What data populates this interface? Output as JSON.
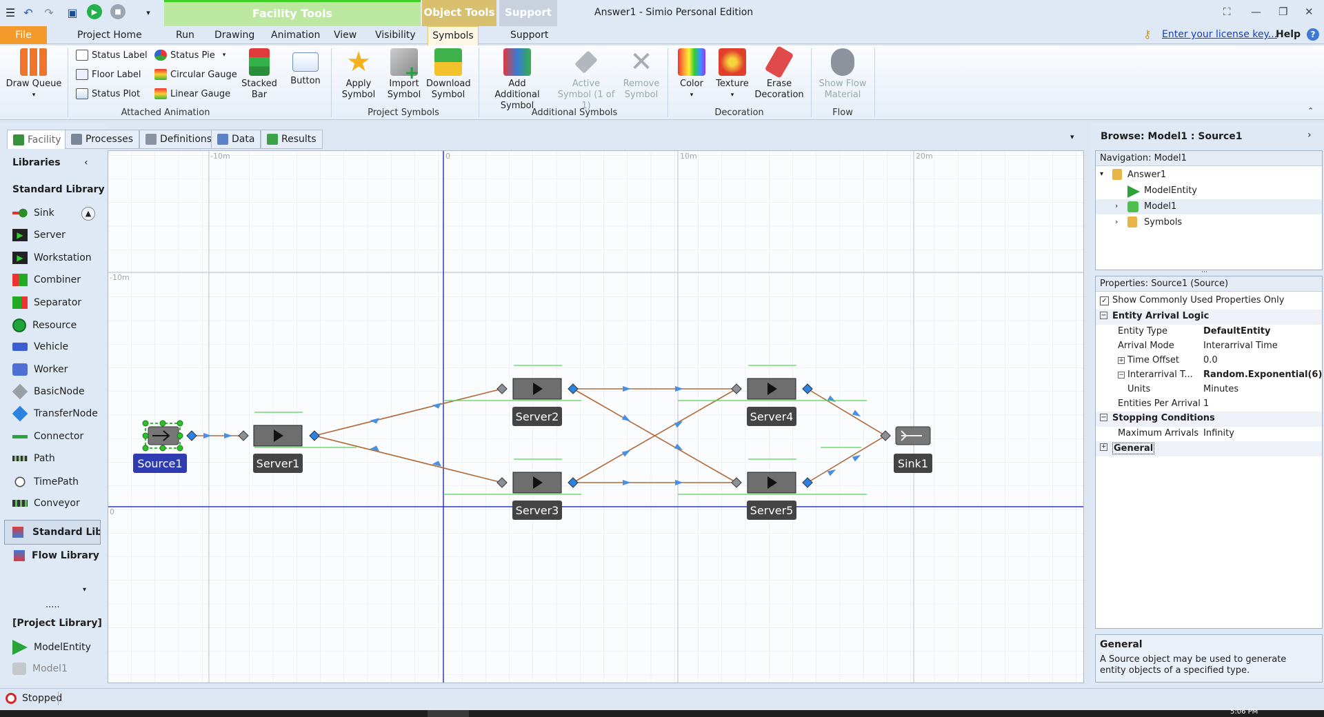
{
  "window": {
    "title": "Answer1 - Simio Personal Edition",
    "controls": [
      "⛶",
      "—",
      "❐",
      "✕"
    ]
  },
  "context_tabs": {
    "facility_tools": "Facility Tools",
    "object_tools": "Object Tools",
    "support": "Support"
  },
  "ribbon_tabs": {
    "file": "File",
    "items": [
      "Project Home",
      "Run",
      "Drawing",
      "Animation",
      "View",
      "Visibility"
    ],
    "active": "Symbols",
    "support": "Support"
  },
  "license_link": "Enter your license key...",
  "help": "Help",
  "ribbon": {
    "draw_queue": "Draw Queue",
    "attached_animation": {
      "status_label": "Status Label",
      "floor_label": "Floor Label",
      "status_plot": "Status Plot",
      "status_pie": "Status Pie",
      "circular_gauge": "Circular Gauge",
      "linear_gauge": "Linear Gauge",
      "stacked_bar": "Stacked Bar",
      "button": "Button",
      "group": "Attached Animation"
    },
    "project_symbols": {
      "apply_symbol": "Apply Symbol",
      "import_symbol": "Import Symbol",
      "download_symbol": "Download Symbol",
      "group": "Project Symbols"
    },
    "additional_symbols": {
      "add_additional": "Add Additional Symbol",
      "active_symbol": "Active Symbol (1 of 1)",
      "remove_symbol": "Remove Symbol",
      "group": "Additional Symbols"
    },
    "decoration": {
      "color": "Color",
      "texture": "Texture",
      "erase": "Erase Decoration",
      "group": "Decoration"
    },
    "flow": {
      "show_flow": "Show Flow Material",
      "group": "Flow"
    }
  },
  "doc_tabs": [
    "Facility",
    "Processes",
    "Definitions",
    "Data",
    "Results"
  ],
  "libraries": {
    "title": "Libraries",
    "standard_title": "Standard Library",
    "items": [
      "Sink",
      "Server",
      "Workstation",
      "Combiner",
      "Separator",
      "Resource",
      "Vehicle",
      "Worker",
      "BasicNode",
      "TransferNode",
      "Connector",
      "Path",
      "TimePath",
      "Conveyor"
    ],
    "tab_standard": "Standard Libr",
    "tab_flow": "Flow Library",
    "ellipsis": ".....",
    "project_title": "[Project Library]",
    "project_items": [
      "ModelEntity",
      "Model1"
    ]
  },
  "canvas": {
    "ruler_top": [
      "-10m",
      "0",
      "10m",
      "20m"
    ],
    "ruler_left": [
      "-10m",
      "0"
    ],
    "objects": {
      "source": "Source1",
      "server1": "Server1",
      "server2": "Server2",
      "server3": "Server3",
      "server4": "Server4",
      "server5": "Server5",
      "sink": "Sink1"
    }
  },
  "browse": {
    "title": "Browse: Model1 : Source1",
    "nav_header": "Navigation: Model1",
    "tree": {
      "root": "Answer1",
      "items": [
        "ModelEntity",
        "Model1",
        "Symbols"
      ]
    }
  },
  "properties": {
    "header": "Properties: Source1 (Source)",
    "show_common": "Show Commonly Used Properties Only",
    "sections": {
      "arrival": "Entity Arrival Logic",
      "stopping": "Stopping Conditions",
      "general": "General"
    },
    "rows": [
      {
        "k": "Entity Type",
        "v": "DefaultEntity"
      },
      {
        "k": "Arrival Mode",
        "v": "Interarrival Time"
      },
      {
        "k": "Time Offset",
        "v": "0.0"
      },
      {
        "k": "Interarrival T...",
        "v": "Random.Exponential(6)"
      },
      {
        "k": "Units",
        "v": "Minutes"
      },
      {
        "k": "Entities Per Arrival",
        "v": "1"
      },
      {
        "k": "Maximum Arrivals",
        "v": "Infinity"
      }
    ],
    "desc_title": "General",
    "desc_text": "A Source object may be used to generate entity objects of a specified type."
  },
  "status": {
    "text": "Stopped",
    "clock": "5:06 PM"
  }
}
